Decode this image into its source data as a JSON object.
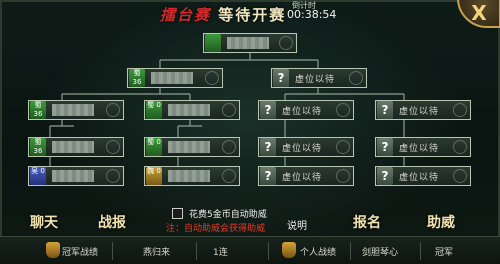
{
  "header": {
    "title_red": "擂台赛",
    "title_white": "等待开赛",
    "countdown_label": "倒计时",
    "countdown_value": "00:38:54",
    "close_label": "X"
  },
  "bracket": {
    "wait_text": "虚位以待",
    "final": {
      "badge": "",
      "faction": "shu"
    },
    "semis": [
      {
        "badge": "蜀 36",
        "faction": "shu",
        "filled": true
      },
      {
        "badge": "?",
        "faction": "unk",
        "filled": false
      }
    ],
    "quarters": [
      {
        "badge": "蜀 36",
        "faction": "shu",
        "filled": true
      },
      {
        "badge": "蜀 0",
        "faction": "shu",
        "filled": true
      },
      {
        "badge": "?",
        "faction": "unk",
        "filled": false
      },
      {
        "badge": "?",
        "faction": "unk",
        "filled": false
      }
    ],
    "round1": [
      {
        "badge": "蜀 36",
        "faction": "shu",
        "filled": true
      },
      {
        "badge": "吴 0",
        "faction": "wu",
        "filled": true
      },
      {
        "badge": "蜀 0",
        "faction": "shu",
        "filled": true
      },
      {
        "badge": "魏 0",
        "faction": "wei",
        "filled": true
      },
      {
        "badge": "?",
        "faction": "unk",
        "filled": false
      },
      {
        "badge": "?",
        "faction": "unk",
        "filled": false
      },
      {
        "badge": "?",
        "faction": "unk",
        "filled": false
      },
      {
        "badge": "?",
        "faction": "unk",
        "filled": false
      }
    ]
  },
  "actions": {
    "chat": "聊天",
    "battle_report": "战报",
    "signup": "报名",
    "cheer": "助威",
    "explain": "说明",
    "auto_cheer_label": "花费5金币自动助威",
    "note": "注：自动助威会获得助威"
  },
  "bottom_bar": {
    "champion_record": "冠军战绩",
    "player_name": "燕归来",
    "streak": "1连",
    "personal_record": "个人战绩",
    "personal_player": "剑胆琴心",
    "personal_result": "冠军"
  },
  "colors": {
    "accent_red": "#d22b2b",
    "gold": "#c8a24a",
    "slot_border": "#b9c7b2"
  }
}
